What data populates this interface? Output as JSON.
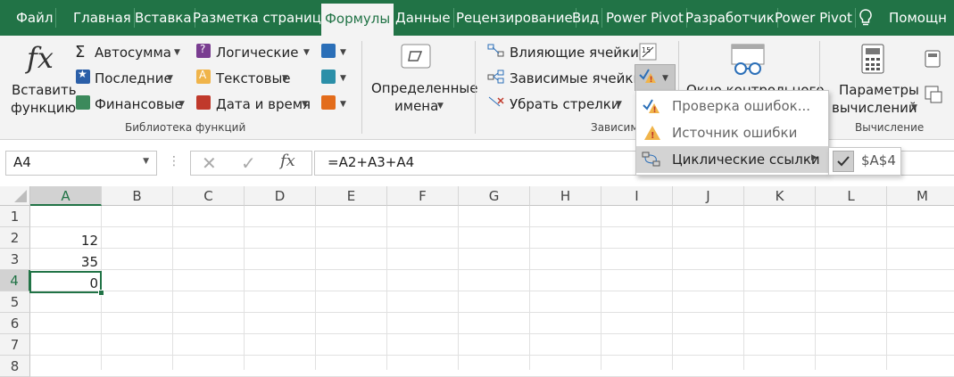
{
  "tabs": [
    "Файл",
    "Главная",
    "Вставка",
    "Разметка страницы",
    "Формулы",
    "Данные",
    "Рецензирование",
    "Вид",
    "Power Pivot",
    "Разработчик",
    "Power Pivot",
    "Помощн"
  ],
  "active_tab": "Формулы",
  "ribbon": {
    "insert_function": [
      "Вставить",
      "функцию"
    ],
    "autosum": "Автосумма",
    "recent": "Последние",
    "financial": "Финансовые",
    "logical": "Логические",
    "text": "Текстовые",
    "datetime": "Дата и время",
    "library_group": "Библиотека функций",
    "defined_names": [
      "Определенные",
      "имена"
    ],
    "trace_precedents": "Влияющие ячейки",
    "trace_dependents": "Зависимые ячейки",
    "remove_arrows": "Убрать стрелки",
    "audit_group": "Зависим",
    "watch_window": "Окно контрольного",
    "calc_options": [
      "Параметры",
      "вычислений"
    ],
    "calc_group": "Вычисление"
  },
  "menu": {
    "items": [
      "Проверка ошибок...",
      "Источник ошибки",
      "Циклические ссылки"
    ],
    "submenu_item": "$A$4"
  },
  "formula_bar": {
    "name_box": "A4",
    "fx": "fx",
    "formula": "=A2+A3+A4"
  },
  "grid": {
    "columns": [
      "A",
      "B",
      "C",
      "D",
      "E",
      "F",
      "G",
      "H",
      "I",
      "J",
      "K",
      "L",
      "M"
    ],
    "rows": [
      "1",
      "2",
      "3",
      "4",
      "5",
      "6",
      "7",
      "8"
    ],
    "cells": {
      "A2": "12",
      "A3": "35",
      "A4": "0"
    },
    "selected": "A4"
  },
  "colors": {
    "accent": "#217346",
    "ribbon": "#f3f3f3"
  }
}
